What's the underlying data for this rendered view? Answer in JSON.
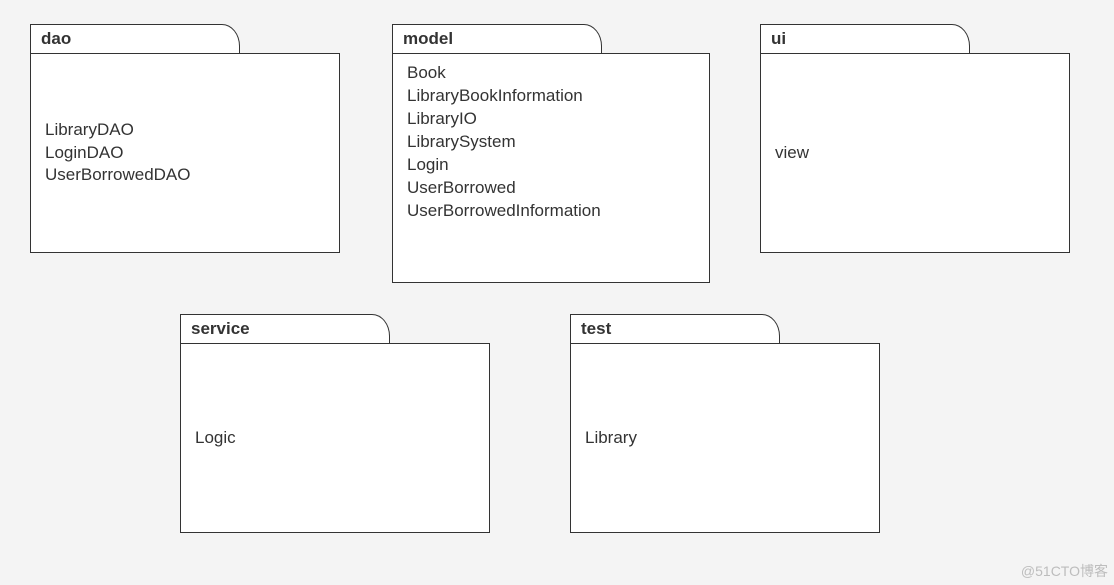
{
  "packages": {
    "dao": {
      "name": "dao",
      "classes": [
        "LibraryDAO",
        "LoginDAO",
        "UserBorrowedDAO"
      ]
    },
    "model": {
      "name": "model",
      "classes": [
        "Book",
        "LibraryBookInformation",
        "LibraryIO",
        "LibrarySystem",
        "Login",
        "UserBorrowed",
        "UserBorrowedInformation"
      ]
    },
    "ui": {
      "name": "ui",
      "classes": [
        "view"
      ]
    },
    "service": {
      "name": "service",
      "classes": [
        "Logic"
      ]
    },
    "test": {
      "name": "test",
      "classes": [
        "Library"
      ]
    }
  },
  "watermark": "@51CTO博客"
}
